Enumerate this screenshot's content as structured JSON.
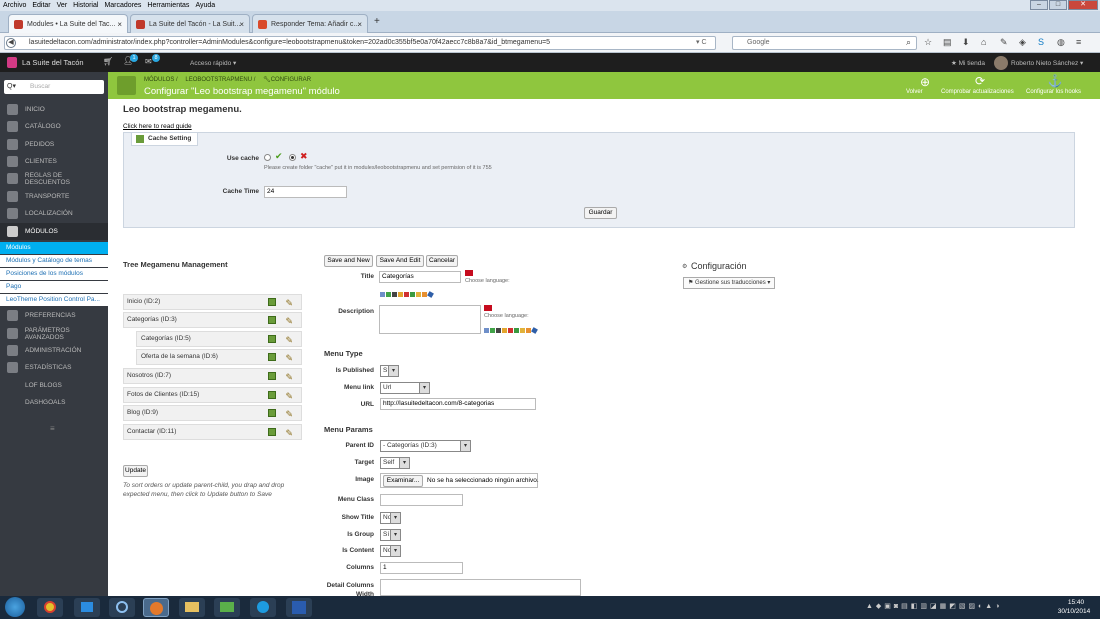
{
  "browser": {
    "menu": [
      "Archivo",
      "Editar",
      "Ver",
      "Historial",
      "Marcadores",
      "Herramientas",
      "Ayuda"
    ],
    "tabs": [
      {
        "title": "Modules • La Suite del Tac...",
        "active": true
      },
      {
        "title": "La Suite del Tacón - La Suit...",
        "active": false
      },
      {
        "title": "Responder Tema: Añadir c...",
        "active": false
      }
    ],
    "new_tab_glyph": "+",
    "url": "lasuitedeltacon.com/administrator/index.php?controller=AdminModules&configure=leobootstrapmenu&token=202ad0c355bf5e0a70f42aecc7c8b8a7&id_btmegamenu=5",
    "search_engine": "Google",
    "search_placeholder": "Google"
  },
  "admin_bar": {
    "shop_name": "La Suite del Tacón",
    "badge_orders": "1",
    "badge_messages": "8",
    "quick_access": "Acceso rápido",
    "my_store": "Mi tienda",
    "user": "Roberto Nieto Sánchez"
  },
  "sidebar": {
    "search_placeholder": "Buscar",
    "items": [
      {
        "label": "Inicio",
        "icon": "dashboard-icon"
      },
      {
        "label": "Catálogo",
        "icon": "catalog-icon"
      },
      {
        "label": "Pedidos",
        "icon": "orders-icon"
      },
      {
        "label": "Clientes",
        "icon": "customers-icon"
      },
      {
        "label": "Reglas de descuentos",
        "icon": "discounts-icon"
      },
      {
        "label": "Transporte",
        "icon": "shipping-icon"
      },
      {
        "label": "Localización",
        "icon": "globe-icon"
      },
      {
        "label": "Módulos",
        "icon": "puzzle-icon"
      }
    ],
    "sub_items": [
      "Módulos",
      "Módulos y Catálogo de temas",
      "Posiciones de los módulos",
      "Pago",
      "LeoTheme Position Control Pa..."
    ],
    "items2": [
      {
        "label": "Preferencias",
        "icon": "wrench-icon"
      },
      {
        "label": "Parámetros avanzados",
        "icon": "gears-icon"
      },
      {
        "label": "Administración",
        "icon": "gear-icon"
      },
      {
        "label": "Estadísticas",
        "icon": "stats-icon"
      },
      {
        "label": "LOF BLOGS",
        "icon": ""
      },
      {
        "label": "DASHGOALS",
        "icon": ""
      }
    ]
  },
  "header": {
    "breadcrumb": [
      "Módulos",
      "leobootstrapmenu",
      "Configurar"
    ],
    "title": "Configurar \"Leo bootstrap megamenu\" módulo",
    "actions": [
      {
        "label": "Volver",
        "icon": "back-icon"
      },
      {
        "label": "Comprobar actualizaciones",
        "icon": "refresh-icon"
      },
      {
        "label": "Configurar los hooks",
        "icon": "anchor-icon"
      }
    ]
  },
  "main": {
    "module_title": "Leo bootstrap megamenu.",
    "guide_link": "Click here to read guide",
    "cache": {
      "panel_title": "Cache Setting",
      "use_cache_label": "Use cache",
      "note": "Please create folder \"cache\" put it in modules/leobootstrapmenu and set permision of it is 755",
      "cache_time_label": "Cache Time",
      "cache_time_value": "24",
      "save_label": "Guardar"
    },
    "tree": {
      "title": "Tree Megamenu Management",
      "items": [
        {
          "label": "Inicio (ID:2)",
          "level": 0
        },
        {
          "label": "Categorías (ID:3)",
          "level": 0
        },
        {
          "label": "Categorías (ID:5)",
          "level": 1
        },
        {
          "label": "Oferta de la semana (ID:6)",
          "level": 1
        },
        {
          "label": "Nosotros (ID:7)",
          "level": 0
        },
        {
          "label": "Fotos de Clientes (ID:15)",
          "level": 0
        },
        {
          "label": "Blog (ID:9)",
          "level": 0
        },
        {
          "label": "Contactar (ID:11)",
          "level": 0
        }
      ],
      "update_label": "Update",
      "help": "To sort orders or update parent-child, you drap and drop expected menu, then click to Update button to Save"
    },
    "form": {
      "buttons": [
        "Save and New",
        "Save And Edit",
        "Cancelar"
      ],
      "title_label": "Title",
      "title_value": "Categorías",
      "choose_language": "Choose language:",
      "description_label": "Description",
      "menu_type_heading": "Menu Type",
      "is_published_label": "Is Published",
      "is_published_value": "Sí",
      "menu_link_label": "Menu link",
      "menu_link_value": "Url",
      "url_label": "URL",
      "url_value": "http://lasuitedeltacon.com/8-categorias",
      "menu_params_heading": "Menu Params",
      "parent_id_label": "Parent ID",
      "parent_id_value": "- Categorías (ID:3)",
      "target_label": "Target",
      "target_value": "Self",
      "image_label": "Image",
      "browse_label": "Examinar...",
      "no_file": "No se ha seleccionado ningún archivo.",
      "menu_class_label": "Menu Class",
      "show_title_label": "Show Title",
      "show_title_value": "No",
      "is_group_label": "Is Group",
      "is_group_value": "Sí",
      "is_content_label": "Is Content",
      "is_content_value": "No",
      "columns_label": "Columns",
      "columns_value": "1",
      "detail_columns_label": "Detail Columns Width"
    },
    "config": {
      "title": "Configuración",
      "translations_label": "Gestione sus traducciones"
    }
  },
  "taskbar": {
    "time": "15:40",
    "date": "30/10/2014"
  },
  "colors": {
    "header_green": "#8fc63e",
    "sidebar_bg": "#363a41",
    "active_submenu": "#00aff0",
    "admin_bar": "#1e1e1e"
  }
}
